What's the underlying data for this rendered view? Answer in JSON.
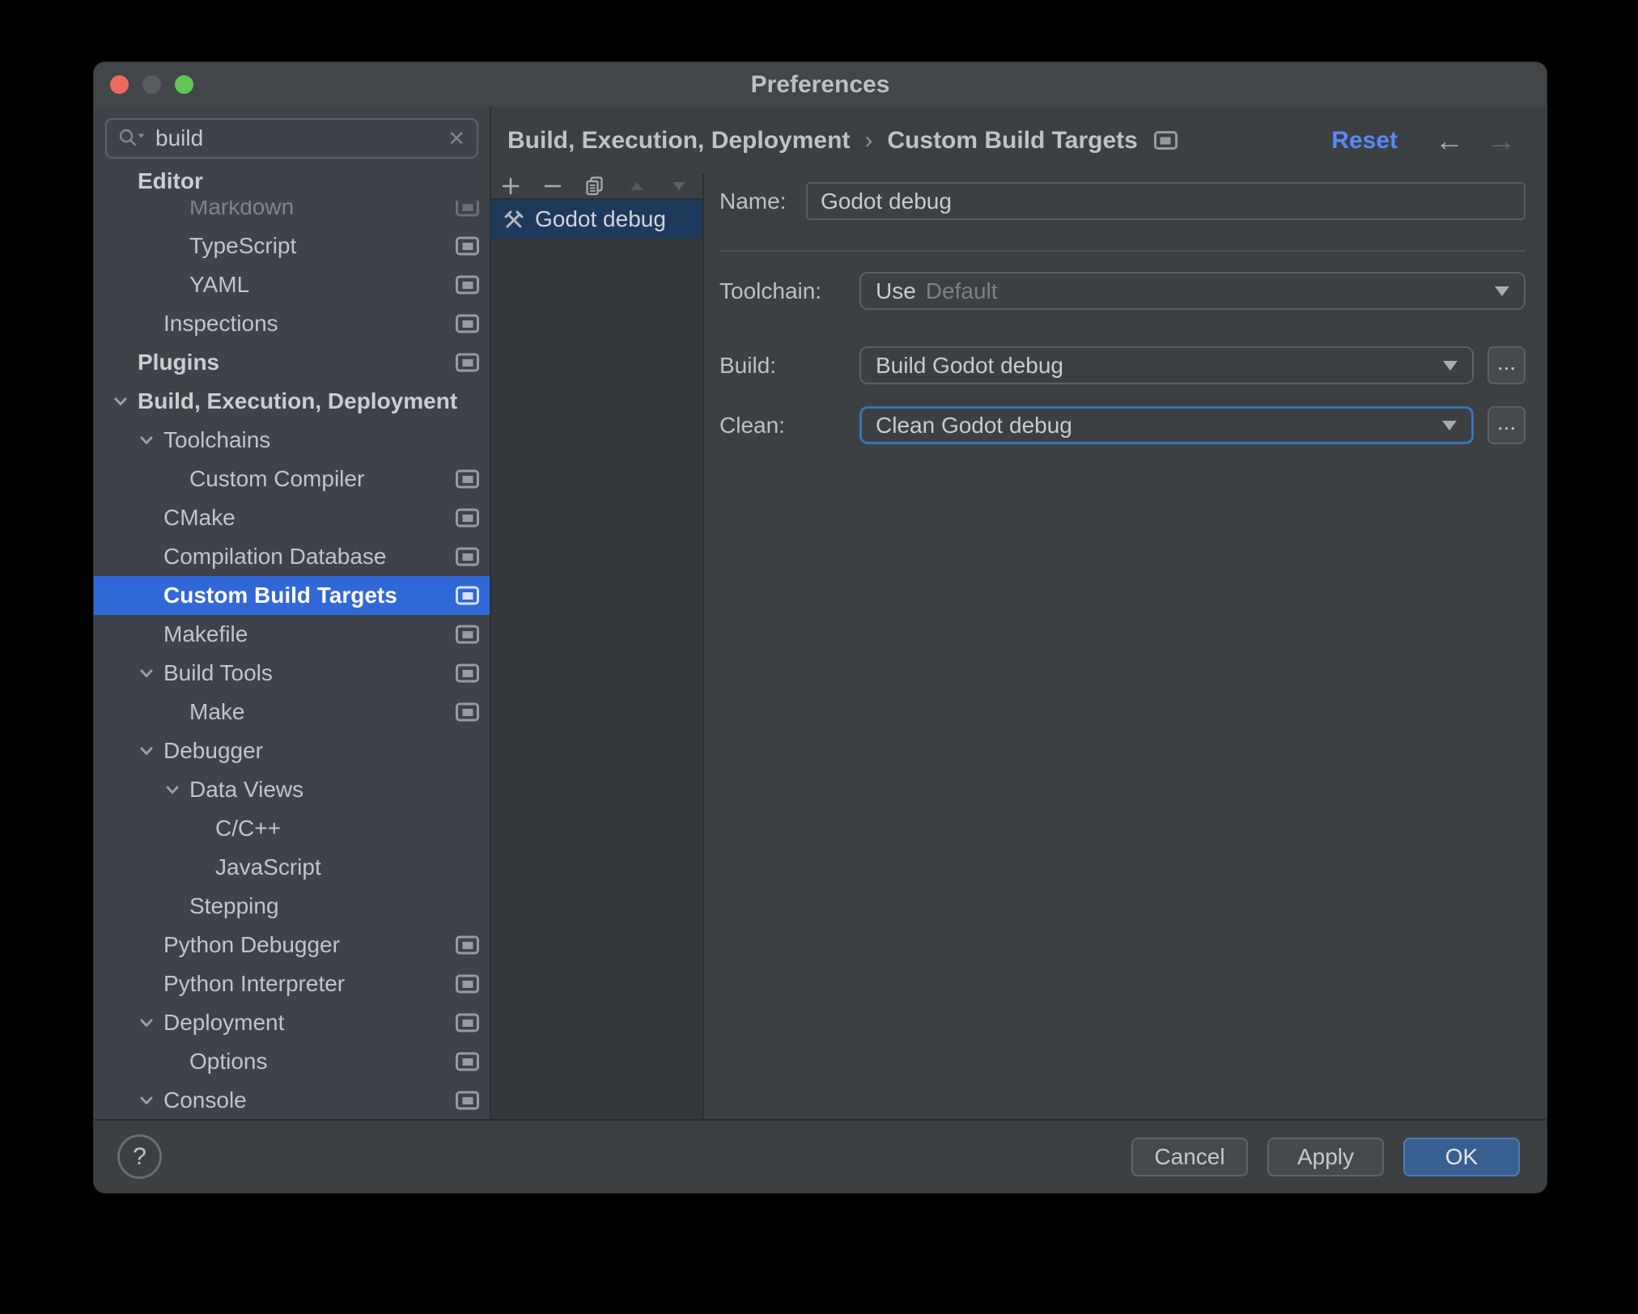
{
  "window": {
    "title": "Preferences"
  },
  "search": {
    "value": "build"
  },
  "tree": {
    "items": [
      {
        "label": "Editor",
        "level": 0,
        "bold": true
      },
      {
        "label": "Markdown",
        "level": 2,
        "icon": true,
        "faded": true
      },
      {
        "label": "TypeScript",
        "level": 2,
        "icon": true
      },
      {
        "label": "YAML",
        "level": 2,
        "icon": true
      },
      {
        "label": "Inspections",
        "level": 1,
        "icon": true
      },
      {
        "label": "Plugins",
        "level": 0,
        "bold": true,
        "icon": true
      },
      {
        "label": "Build, Execution, Deployment",
        "level": 0,
        "bold": true,
        "chevron": true
      },
      {
        "label": "Toolchains",
        "level": 1,
        "chevron": true
      },
      {
        "label": "Custom Compiler",
        "level": 2,
        "icon": true
      },
      {
        "label": "CMake",
        "level": 1,
        "icon": true
      },
      {
        "label": "Compilation Database",
        "level": 1,
        "icon": true
      },
      {
        "label": "Custom Build Targets",
        "level": 1,
        "icon": true,
        "selected": true
      },
      {
        "label": "Makefile",
        "level": 1,
        "icon": true
      },
      {
        "label": "Build Tools",
        "level": 1,
        "chevron": true,
        "icon": true
      },
      {
        "label": "Make",
        "level": 2,
        "icon": true
      },
      {
        "label": "Debugger",
        "level": 1,
        "chevron": true
      },
      {
        "label": "Data Views",
        "level": 2,
        "chevron": true
      },
      {
        "label": "C/C++",
        "level": 3
      },
      {
        "label": "JavaScript",
        "level": 3
      },
      {
        "label": "Stepping",
        "level": 2
      },
      {
        "label": "Python Debugger",
        "level": 1,
        "icon": true
      },
      {
        "label": "Python Interpreter",
        "level": 1,
        "icon": true
      },
      {
        "label": "Deployment",
        "level": 1,
        "chevron": true,
        "icon": true
      },
      {
        "label": "Options",
        "level": 2,
        "icon": true
      },
      {
        "label": "Console",
        "level": 1,
        "chevron": true,
        "icon": true
      }
    ]
  },
  "breadcrumb": {
    "part1": "Build, Execution, Deployment",
    "separator": "›",
    "part2": "Custom Build Targets"
  },
  "header": {
    "reset_label": "Reset",
    "back_arrow": "←",
    "forward_arrow": "→"
  },
  "targets_list": {
    "items": [
      {
        "label": "Godot debug",
        "selected": true
      }
    ]
  },
  "form": {
    "name_label": "Name:",
    "name_value": "Godot debug",
    "toolchain_label": "Toolchain:",
    "toolchain_prefix": "Use",
    "toolchain_value": "Default",
    "build_label": "Build:",
    "build_value": "Build Godot debug",
    "clean_label": "Clean:",
    "clean_value": "Clean Godot debug",
    "more_label": "..."
  },
  "footer": {
    "help": "?",
    "cancel": "Cancel",
    "apply": "Apply",
    "ok": "OK"
  },
  "colors": {
    "tree_selection": "#3168D8",
    "list_selection": "#1D3A5C",
    "link_blue": "#548AF7",
    "ok_button": "#375F8F",
    "focus_ring": "#3A72B6"
  }
}
